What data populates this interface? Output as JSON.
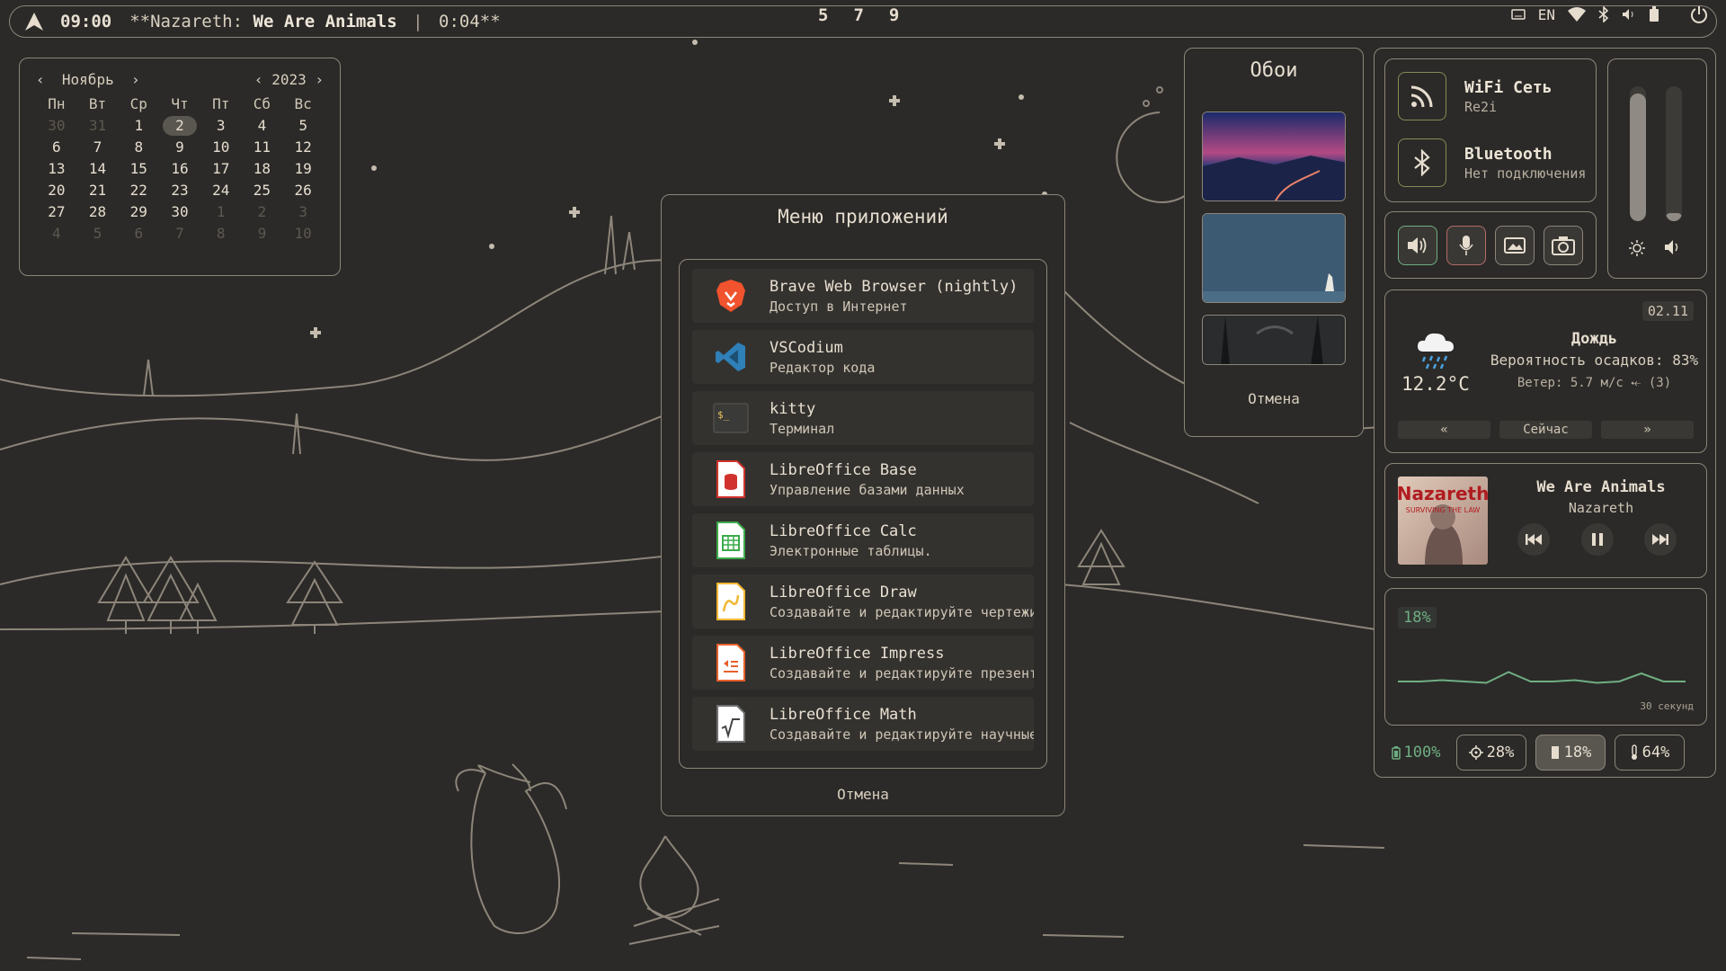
{
  "topbar": {
    "clock": "09:00",
    "now_playing_prefix": "**Nazareth:",
    "now_playing_song": "We Are Animals",
    "now_playing_sep": "|",
    "now_playing_time": "0:04**",
    "workspaces": [
      "5",
      "7",
      "9"
    ],
    "keyboard_layout": "EN",
    "icons": [
      "arch-logo-icon",
      "keyboard-icon",
      "wifi-icon",
      "bluetooth-icon",
      "volume-icon",
      "battery-icon",
      "power-icon"
    ]
  },
  "calendar": {
    "month": "Ноябрь",
    "year": "2023",
    "prev": "‹",
    "next": "›",
    "weekdays": [
      "Пн",
      "Вт",
      "Ср",
      "Чт",
      "Пт",
      "Сб",
      "Вс"
    ],
    "days": [
      {
        "d": "30",
        "m": true
      },
      {
        "d": "31",
        "m": true
      },
      {
        "d": "1"
      },
      {
        "d": "2",
        "today": true
      },
      {
        "d": "3"
      },
      {
        "d": "4"
      },
      {
        "d": "5"
      },
      {
        "d": "6"
      },
      {
        "d": "7"
      },
      {
        "d": "8"
      },
      {
        "d": "9"
      },
      {
        "d": "10"
      },
      {
        "d": "11"
      },
      {
        "d": "12"
      },
      {
        "d": "13"
      },
      {
        "d": "14"
      },
      {
        "d": "15"
      },
      {
        "d": "16"
      },
      {
        "d": "17"
      },
      {
        "d": "18"
      },
      {
        "d": "19"
      },
      {
        "d": "20"
      },
      {
        "d": "21"
      },
      {
        "d": "22"
      },
      {
        "d": "23"
      },
      {
        "d": "24"
      },
      {
        "d": "25"
      },
      {
        "d": "26"
      },
      {
        "d": "27"
      },
      {
        "d": "28"
      },
      {
        "d": "29"
      },
      {
        "d": "30"
      },
      {
        "d": "1",
        "m": true
      },
      {
        "d": "2",
        "m": true
      },
      {
        "d": "3",
        "m": true
      },
      {
        "d": "4",
        "m": true
      },
      {
        "d": "5",
        "m": true
      },
      {
        "d": "6",
        "m": true
      },
      {
        "d": "7",
        "m": true
      },
      {
        "d": "8",
        "m": true
      },
      {
        "d": "9",
        "m": true
      },
      {
        "d": "10",
        "m": true
      }
    ]
  },
  "app_menu": {
    "title": "Меню приложений",
    "cancel": "Отмена",
    "apps": [
      {
        "name": "Brave Web Browser (nightly)",
        "desc": "Доступ в Интернет",
        "icon": "brave-icon"
      },
      {
        "name": "VSCodium",
        "desc": "Редактор кода",
        "icon": "vscodium-icon"
      },
      {
        "name": "kitty",
        "desc": "Терминал",
        "icon": "terminal-icon"
      },
      {
        "name": "LibreOffice Base",
        "desc": "Управление базами данных",
        "icon": "libreoffice-base-icon"
      },
      {
        "name": "LibreOffice Calc",
        "desc": "Электронные таблицы.",
        "icon": "libreoffice-calc-icon"
      },
      {
        "name": "LibreOffice Draw",
        "desc": "Создавайте и редактируйте чертежи, т",
        "icon": "libreoffice-draw-icon"
      },
      {
        "name": "LibreOffice Impress",
        "desc": "Создавайте и редактируйте презентаци",
        "icon": "libreoffice-impress-icon"
      },
      {
        "name": "LibreOffice Math",
        "desc": "Создавайте и редактируйте научные фо",
        "icon": "libreoffice-math-icon"
      }
    ]
  },
  "wallpapers": {
    "title": "Обои",
    "cancel": "Отмена"
  },
  "network": {
    "wifi_label": "WiFi Сеть",
    "wifi_ssid": "Re2i",
    "bt_label": "Bluetooth",
    "bt_status": "Нет подключения"
  },
  "sliders": {
    "brightness": 0.95,
    "volume": 0.06,
    "brightness_icon": "sun-icon",
    "volume_icon": "speaker-icon"
  },
  "quick_buttons": [
    "speaker-toggle-icon",
    "microphone-icon",
    "screenshot-icon",
    "camera-icon"
  ],
  "weather": {
    "date": "02.11",
    "condition": "Дождь",
    "precip": "Вероятность осадков: 83%",
    "wind": "Ветер: 5.7 м/с ⤝ (3)",
    "temp": "12.2°C",
    "prev": "«",
    "now": "Сейчас",
    "next": "»",
    "icon": "rain-cloud-icon"
  },
  "player": {
    "title": "We Are Animals",
    "artist": "Nazareth",
    "cover_text": "Nazareth",
    "cover_subtext": "SURVIVING THE LAW"
  },
  "monitor": {
    "value": "18%",
    "label": "30 секунд",
    "points": [
      18,
      18,
      19,
      18,
      17,
      25,
      18,
      18,
      19,
      17,
      18,
      24,
      18,
      18
    ]
  },
  "stats": {
    "battery": "100%",
    "cpu": "28%",
    "ram": "18%",
    "temp": "64%"
  },
  "colors": {
    "background": "#2b2a28",
    "border": "#8d857a",
    "text": "#e6ddcf",
    "accent_green": "#6fae82"
  }
}
